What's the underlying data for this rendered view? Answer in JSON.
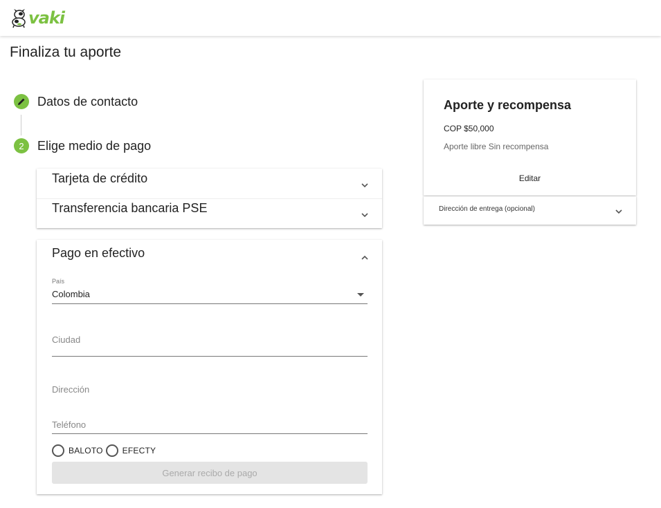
{
  "header": {
    "logo_text": "vaki",
    "mascot_icon": "cow-mascot-icon"
  },
  "page": {
    "title": "Finaliza tu aporte"
  },
  "steps": [
    {
      "marker": "",
      "icon": "pencil-icon",
      "label": "Datos de contacto"
    },
    {
      "marker": "2",
      "label": "Elige medio de pago"
    }
  ],
  "payment": {
    "credit_card": "Tarjeta de crédito",
    "pse": "Transferencia bancaria PSE",
    "cash": {
      "title": "Pago en efectivo",
      "country_label": "País",
      "country_value": "Colombia",
      "city_placeholder": "Ciudad",
      "address_placeholder": "Dirección",
      "phone_placeholder": "Teléfono",
      "options": [
        "BALOTO",
        "EFECTY"
      ],
      "button_label": "Generar recibo de pago"
    }
  },
  "summary": {
    "title": "Aporte y recompensa",
    "amount": "COP $50,000",
    "description": "Aporte libre Sin recompensa",
    "edit_label": "Editar",
    "delivery_label": "Dirección de entrega (opcional)"
  },
  "colors": {
    "brand_green": "#7cc142"
  }
}
